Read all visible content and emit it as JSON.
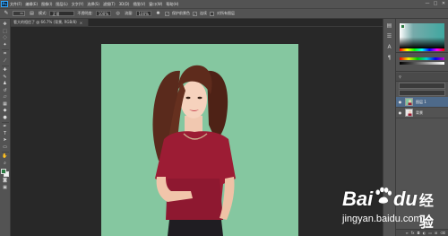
{
  "app": {
    "logo": "Ps"
  },
  "menu": [
    "文件(F)",
    "编辑(E)",
    "图像(I)",
    "图层(L)",
    "文字(Y)",
    "选择(S)",
    "滤镜(T)",
    "3D(D)",
    "视图(V)",
    "窗口(W)",
    "帮助(H)"
  ],
  "window_controls": [
    "—",
    "□",
    "✕"
  ],
  "options_bar": {
    "brush_size": "35",
    "mode_label": "模式:",
    "mode_value": "正常",
    "opacity_label": "不透明度:",
    "opacity_value": "100%",
    "flow_label": "流量:",
    "flow_value": "100%",
    "protect_fg_label": "保护前景色",
    "sample_label": "连续",
    "align_label": "对所有图层"
  },
  "document": {
    "tab_title": "看大的相信了 @ 66.7% (背景, RGB/8)",
    "tab_close": "×"
  },
  "colors": {
    "foreground": "#2b7a42",
    "background": "#f2f2f2",
    "canvas_bg": "#85c7a0",
    "accent": "#31a8ff"
  },
  "tools": [
    "move-icon",
    "marquee-icon",
    "lasso-icon",
    "magic-wand-icon",
    "crop-icon",
    "eyedropper-icon",
    "healing-icon",
    "brush-icon",
    "clone-stamp-icon",
    "history-brush-icon",
    "eraser-icon",
    "gradient-icon",
    "blur-icon",
    "dodge-icon",
    "pen-icon",
    "type-icon",
    "path-select-icon",
    "shape-icon",
    "hand-icon",
    "zoom-icon"
  ],
  "layers": {
    "rows": [
      {
        "name": "图层 1",
        "visible": "●",
        "active": true
      },
      {
        "name": "背景",
        "visible": "●",
        "active": false
      }
    ]
  },
  "watermark": {
    "bai": "Bai",
    "du": "du",
    "jingyan": "经验",
    "url": "jingyan.baidu.com"
  }
}
